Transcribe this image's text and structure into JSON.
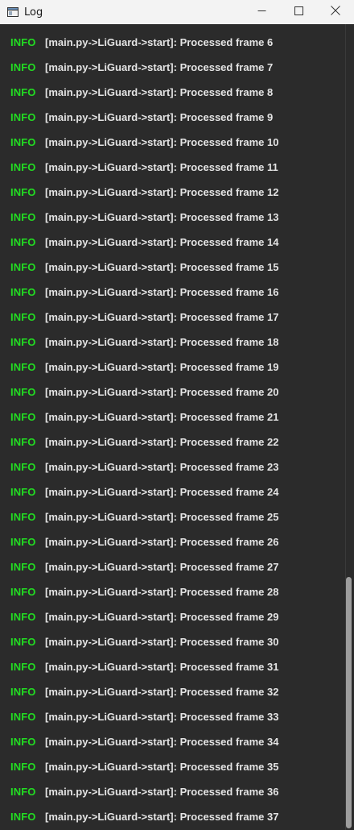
{
  "window": {
    "title": "Log",
    "icon": "window-app-icon",
    "controls": [
      "minimize-icon",
      "maximize-icon",
      "close-icon"
    ]
  },
  "log": {
    "entries": [
      {
        "level": "INFO",
        "message": "[main.py->LiGuard->start]: Processed frame 6"
      },
      {
        "level": "INFO",
        "message": "[main.py->LiGuard->start]: Processed frame 7"
      },
      {
        "level": "INFO",
        "message": "[main.py->LiGuard->start]: Processed frame 8"
      },
      {
        "level": "INFO",
        "message": "[main.py->LiGuard->start]: Processed frame 9"
      },
      {
        "level": "INFO",
        "message": "[main.py->LiGuard->start]: Processed frame 10"
      },
      {
        "level": "INFO",
        "message": "[main.py->LiGuard->start]: Processed frame 11"
      },
      {
        "level": "INFO",
        "message": "[main.py->LiGuard->start]: Processed frame 12"
      },
      {
        "level": "INFO",
        "message": "[main.py->LiGuard->start]: Processed frame 13"
      },
      {
        "level": "INFO",
        "message": "[main.py->LiGuard->start]: Processed frame 14"
      },
      {
        "level": "INFO",
        "message": "[main.py->LiGuard->start]: Processed frame 15"
      },
      {
        "level": "INFO",
        "message": "[main.py->LiGuard->start]: Processed frame 16"
      },
      {
        "level": "INFO",
        "message": "[main.py->LiGuard->start]: Processed frame 17"
      },
      {
        "level": "INFO",
        "message": "[main.py->LiGuard->start]: Processed frame 18"
      },
      {
        "level": "INFO",
        "message": "[main.py->LiGuard->start]: Processed frame 19"
      },
      {
        "level": "INFO",
        "message": "[main.py->LiGuard->start]: Processed frame 20"
      },
      {
        "level": "INFO",
        "message": "[main.py->LiGuard->start]: Processed frame 21"
      },
      {
        "level": "INFO",
        "message": "[main.py->LiGuard->start]: Processed frame 22"
      },
      {
        "level": "INFO",
        "message": "[main.py->LiGuard->start]: Processed frame 23"
      },
      {
        "level": "INFO",
        "message": "[main.py->LiGuard->start]: Processed frame 24"
      },
      {
        "level": "INFO",
        "message": "[main.py->LiGuard->start]: Processed frame 25"
      },
      {
        "level": "INFO",
        "message": "[main.py->LiGuard->start]: Processed frame 26"
      },
      {
        "level": "INFO",
        "message": "[main.py->LiGuard->start]: Processed frame 27"
      },
      {
        "level": "INFO",
        "message": "[main.py->LiGuard->start]: Processed frame 28"
      },
      {
        "level": "INFO",
        "message": "[main.py->LiGuard->start]: Processed frame 29"
      },
      {
        "level": "INFO",
        "message": "[main.py->LiGuard->start]: Processed frame 30"
      },
      {
        "level": "INFO",
        "message": "[main.py->LiGuard->start]: Processed frame 31"
      },
      {
        "level": "INFO",
        "message": "[main.py->LiGuard->start]: Processed frame 32"
      },
      {
        "level": "INFO",
        "message": "[main.py->LiGuard->start]: Processed frame 33"
      },
      {
        "level": "INFO",
        "message": "[main.py->LiGuard->start]: Processed frame 34"
      },
      {
        "level": "INFO",
        "message": "[main.py->LiGuard->start]: Processed frame 35"
      },
      {
        "level": "INFO",
        "message": "[main.py->LiGuard->start]: Processed frame 36"
      },
      {
        "level": "INFO",
        "message": "[main.py->LiGuard->start]: Processed frame 37"
      }
    ]
  },
  "colors": {
    "background": "#2b2b2b",
    "info_level": "#22dd22",
    "message_text": "#e4e4e4",
    "titlebar": "#f3f3f3",
    "scroll_thumb": "#9d9d9d"
  }
}
